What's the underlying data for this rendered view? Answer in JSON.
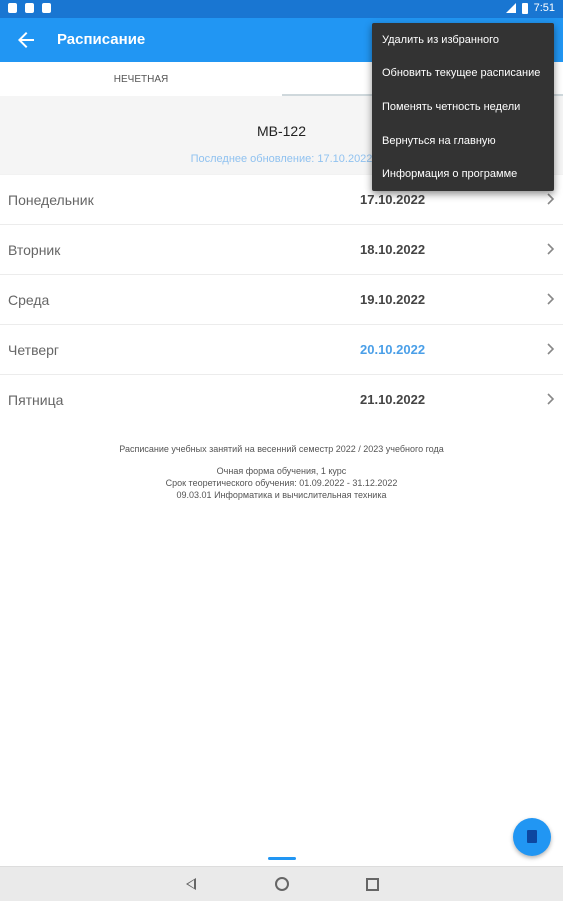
{
  "status_bar": {
    "time": "7:51"
  },
  "app_bar": {
    "title": "Расписание"
  },
  "tabs": [
    {
      "label": "Нечетная"
    },
    {
      "label": ""
    }
  ],
  "header": {
    "group": "МВ-122",
    "last_update": "Последнее обновление: 17.10.2022"
  },
  "days": [
    {
      "day": "Понедельник",
      "date": "17.10.2022",
      "today": false
    },
    {
      "day": "Вторник",
      "date": "18.10.2022",
      "today": false
    },
    {
      "day": "Среда",
      "date": "19.10.2022",
      "today": false
    },
    {
      "day": "Четверг",
      "date": "20.10.2022",
      "today": true
    },
    {
      "day": "Пятница",
      "date": "21.10.2022",
      "today": false
    }
  ],
  "footer": {
    "line1": "Расписание учебных занятий на весенний семестр 2022 / 2023 учебного года",
    "line2": "Очная форма обучения, 1 курс",
    "line3": "Срок теоретического обучения: 01.09.2022 - 31.12.2022",
    "line4": "09.03.01 Информатика и вычислительная техника"
  },
  "menu": [
    {
      "label": "Удалить из избранного"
    },
    {
      "label": "Обновить текущее расписание"
    },
    {
      "label": "Поменять четность недели"
    },
    {
      "label": "Вернуться на главную"
    },
    {
      "label": "Информация о программе"
    }
  ],
  "colors": {
    "app_bar": "#2196f3",
    "status_bar": "#1976d2",
    "today_date": "#4a9fe8",
    "menu_bg": "#333333"
  }
}
